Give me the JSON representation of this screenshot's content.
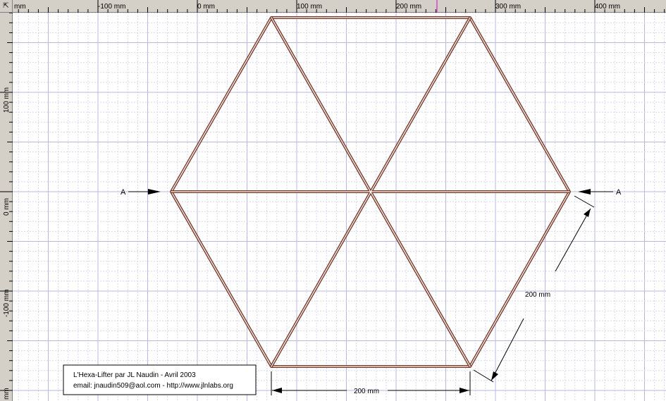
{
  "ruler": {
    "unit": "mm",
    "corner_glyph": "⇱",
    "horizontal_labels": [
      "mm",
      "-100 mm",
      "0 mm",
      "100 mm",
      "200 mm",
      "300 mm",
      "400 mm"
    ],
    "vertical_labels": [
      "100 mm",
      "0 mm",
      "-100 mm",
      "mm"
    ]
  },
  "drawing": {
    "section_marker_left": "A",
    "section_marker_right": "A",
    "dimension_bottom": "200 mm",
    "dimension_side": "200 mm",
    "frame_color": "#7a3a2a"
  },
  "title_block": {
    "line1": "L'Hexa-Lifter par JL Naudin - Avril 2003",
    "line2": "email: jnaudin509@aol.com - http://www.jlnlabs.org"
  }
}
